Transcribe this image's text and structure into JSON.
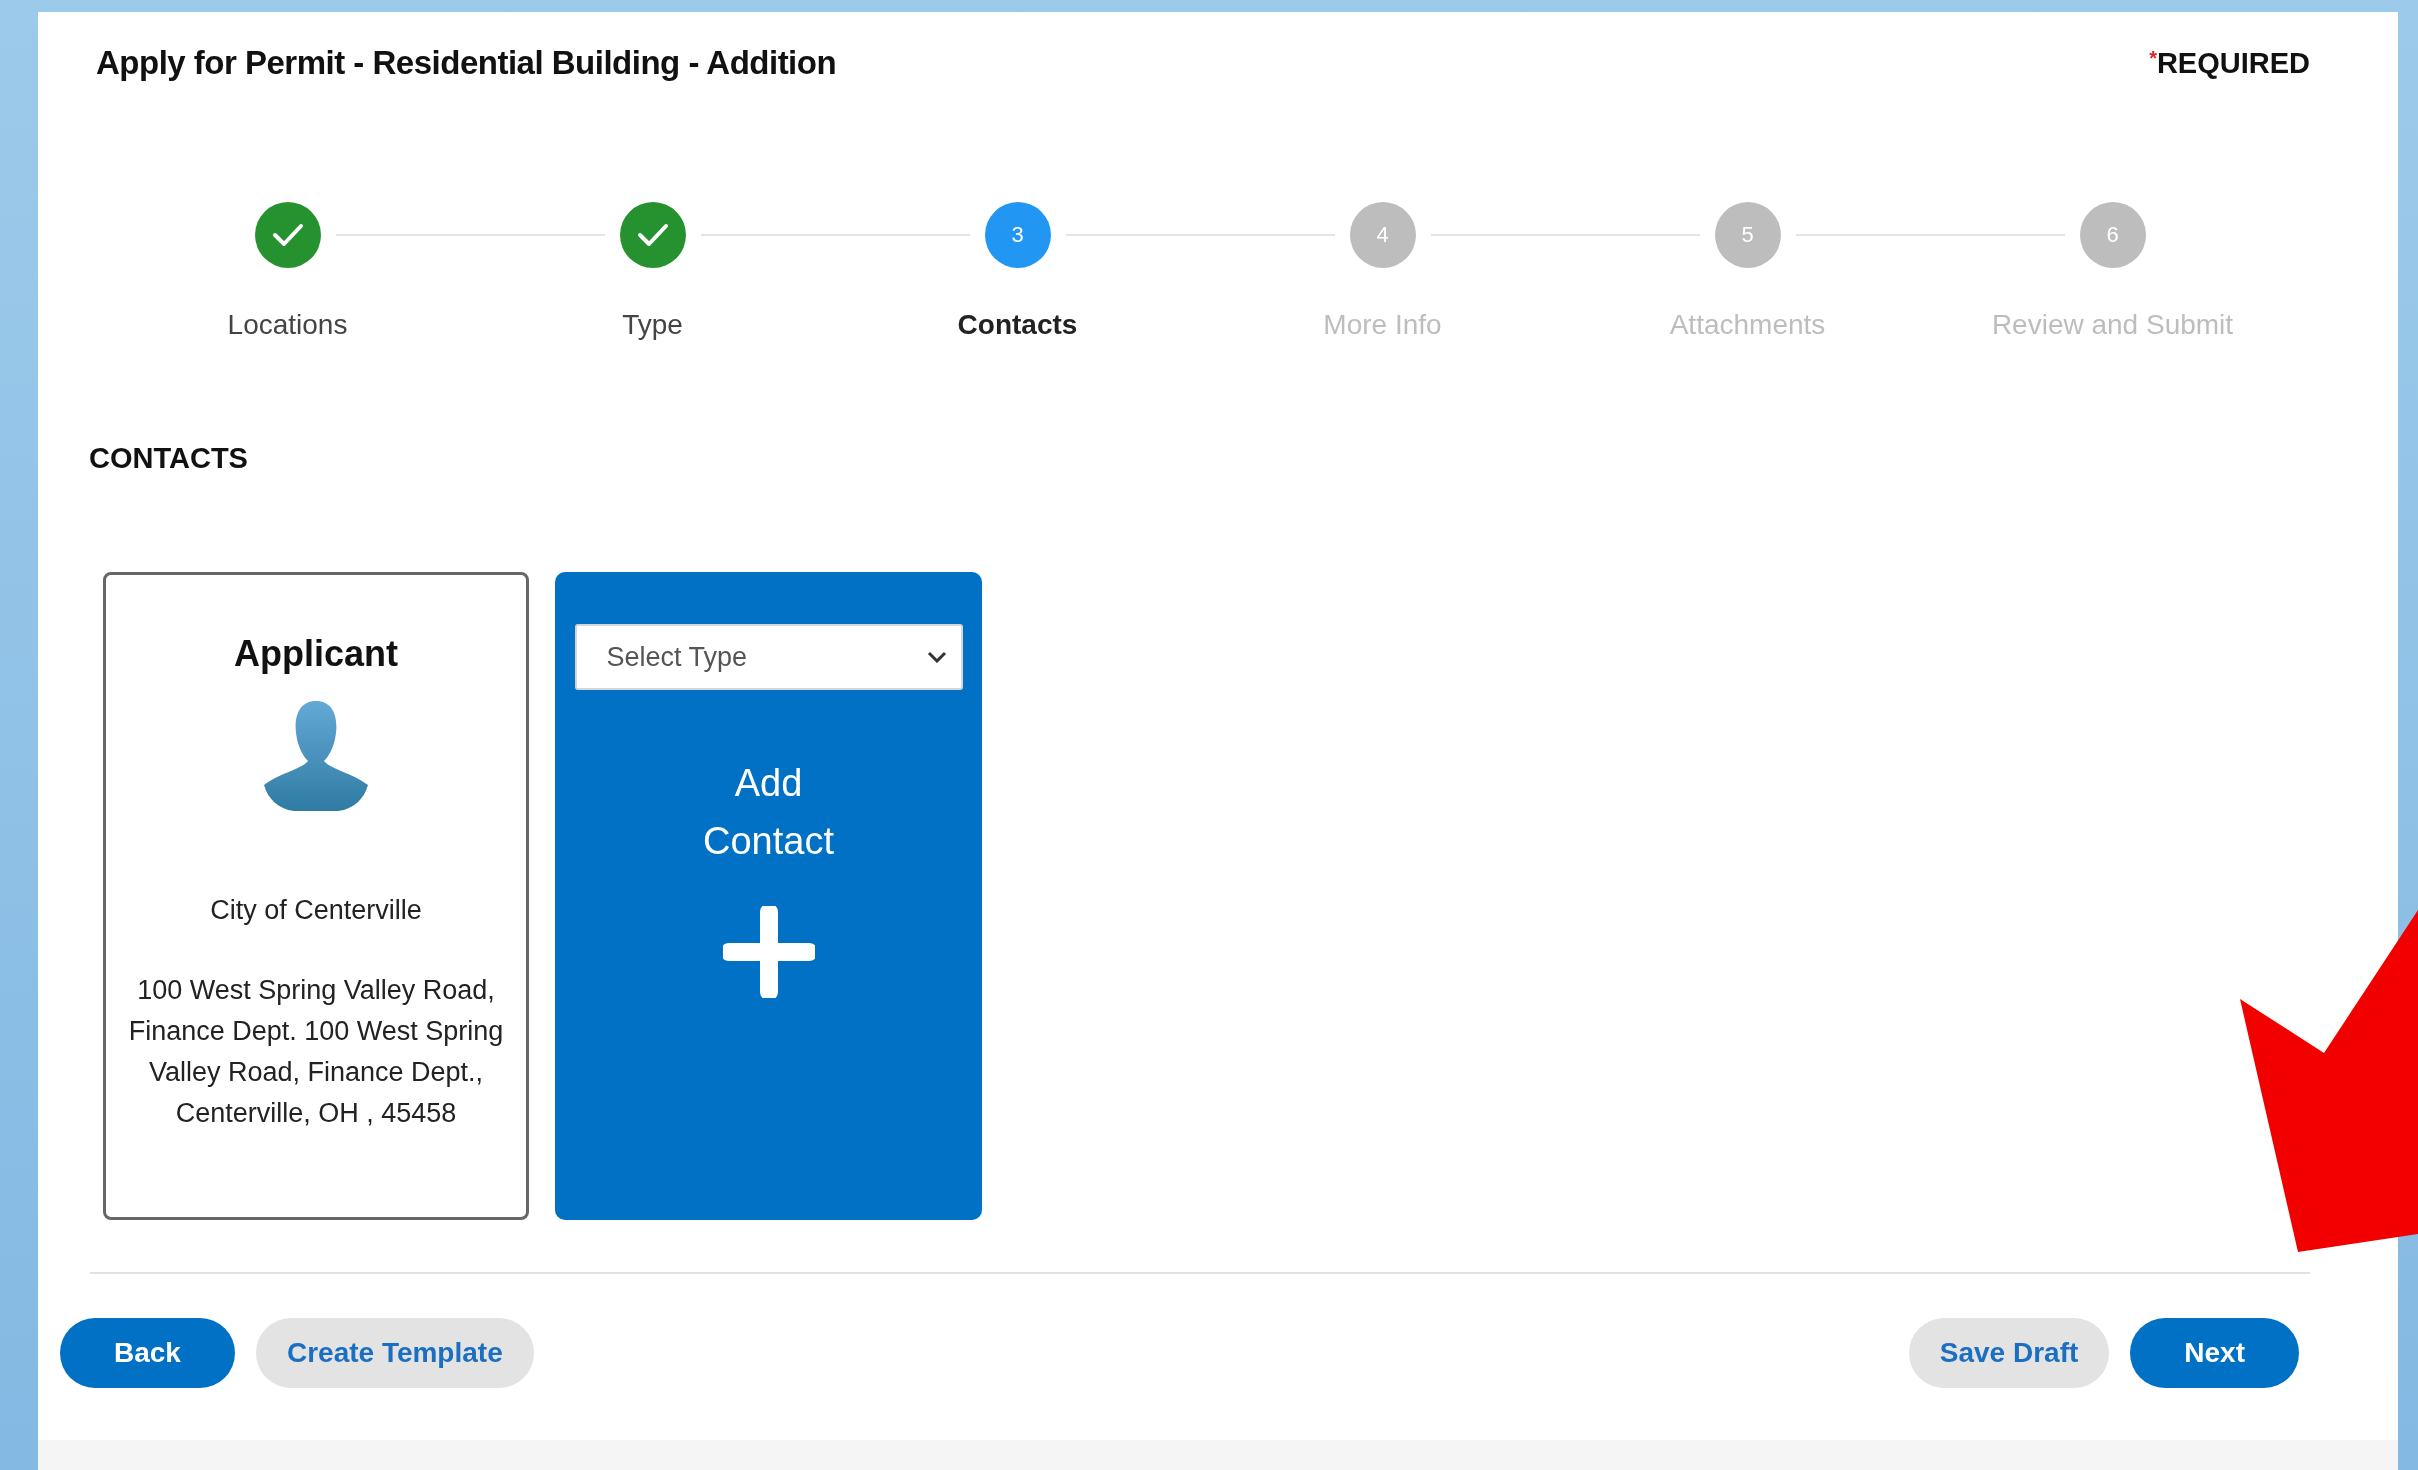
{
  "header": {
    "title": "Apply for Permit - Residential Building - Addition",
    "required_mark": "*",
    "required_label": "REQUIRED"
  },
  "steps": [
    {
      "label": "Locations",
      "completed": true,
      "selected": false
    },
    {
      "label": "Type",
      "completed": true,
      "selected": false
    },
    {
      "number": "3",
      "label": "Contacts",
      "completed": false,
      "selected": true
    },
    {
      "number": "4",
      "label": "More Info",
      "completed": false,
      "selected": false
    },
    {
      "number": "5",
      "label": "Attachments",
      "completed": false,
      "selected": false
    },
    {
      "number": "6",
      "label": "Review and Submit",
      "completed": false,
      "selected": false
    }
  ],
  "section_title": "CONTACTS",
  "cards": [
    {
      "kind": "contact",
      "role": "Applicant",
      "name": "City of Centerville",
      "address": "100 West Spring Valley Road, Finance Dept. 100 West Spring Valley Road, Finance Dept., Centerville, OH , 45458"
    },
    {
      "kind": "add",
      "select_placeholder": "Select Type",
      "label": "Add Contact"
    }
  ],
  "footer": {
    "left_buttons": [
      {
        "label": "Back",
        "kind": "primary"
      },
      {
        "label": "Create Template",
        "kind": "secondary"
      }
    ],
    "right_buttons": [
      {
        "label": "Save Draft",
        "kind": "secondary"
      },
      {
        "label": "Next",
        "kind": "primary"
      }
    ]
  }
}
